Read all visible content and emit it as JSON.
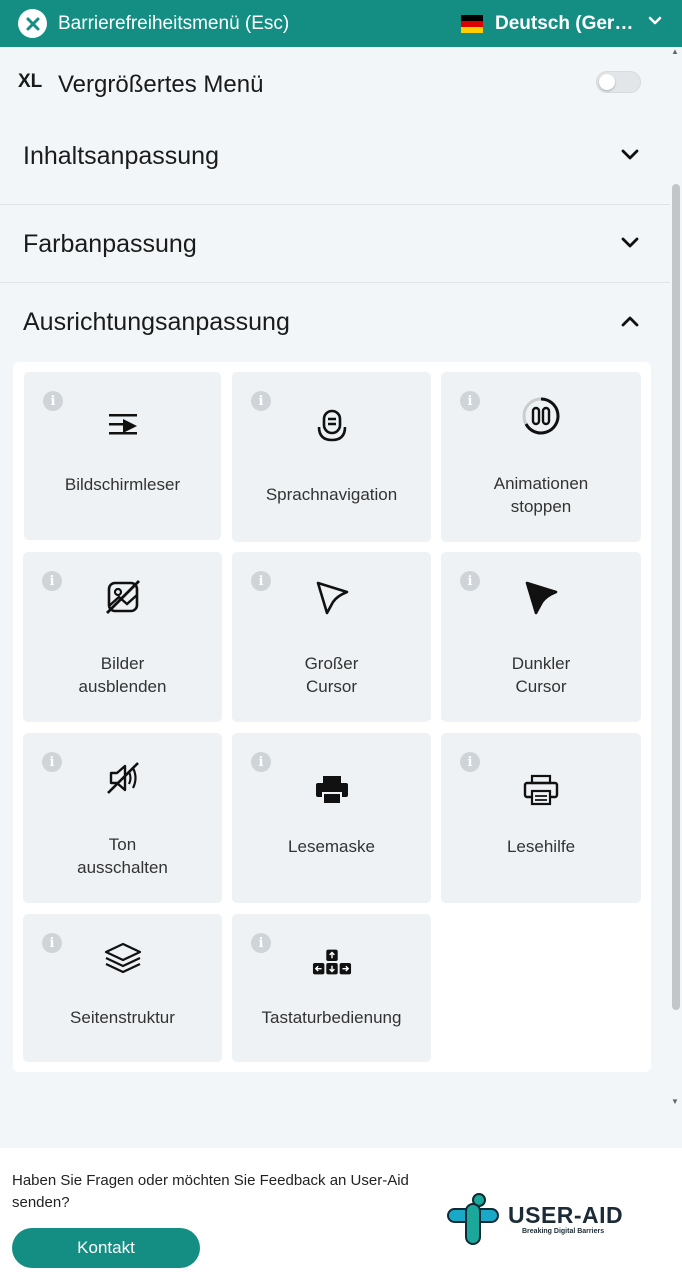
{
  "header": {
    "title": "Barrierefreiheitsmenü (Esc)",
    "language": "Deutsch (German)",
    "flag_colors": [
      "#000000",
      "#dd0000",
      "#ffce00"
    ]
  },
  "xl_menu": {
    "badge": "XL",
    "label": "Vergrößertes Menü",
    "enabled": false
  },
  "sections": [
    {
      "title": "Inhaltsanpassung",
      "expanded": false
    },
    {
      "title": "Farbanpassung",
      "expanded": false
    },
    {
      "title": "Ausrichtungsanpassung",
      "expanded": true
    }
  ],
  "tiles": [
    {
      "label": "Bildschirmleser",
      "icon": "screen-reader-icon"
    },
    {
      "label": "Sprachnavigation",
      "icon": "voice-navigation-icon"
    },
    {
      "label": "Animationen\nstoppen",
      "icon": "stop-animations-icon"
    },
    {
      "label": "Bilder\nausblenden",
      "icon": "hide-images-icon"
    },
    {
      "label": "Großer\nCursor",
      "icon": "big-cursor-icon"
    },
    {
      "label": "Dunkler\nCursor",
      "icon": "dark-cursor-icon"
    },
    {
      "label": "Ton\nausschalten",
      "icon": "mute-sound-icon"
    },
    {
      "label": "Lesemaske",
      "icon": "reading-mask-icon"
    },
    {
      "label": "Lesehilfe",
      "icon": "reading-guide-icon"
    },
    {
      "label": "Seitenstruktur",
      "icon": "page-structure-icon"
    },
    {
      "label": "Tastaturbedienung",
      "icon": "keyboard-navigation-icon"
    }
  ],
  "footer": {
    "question": "Haben Sie Fragen oder möchten Sie Feedback an User-Aid senden?",
    "contact_label": "Kontakt",
    "logo_name": "USER-AID",
    "logo_tagline": "Breaking Digital Barriers"
  },
  "colors": {
    "brand": "#148e83",
    "background": "#f2f6f8",
    "tile": "#eef2f4"
  }
}
